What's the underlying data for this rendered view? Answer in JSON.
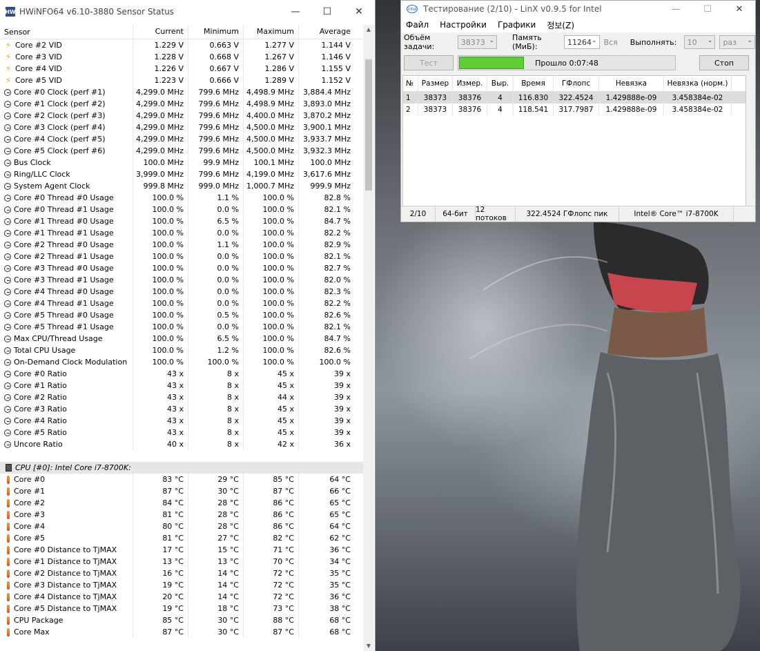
{
  "hwinfo": {
    "title": "HWiNFO64 v6.10-3880 Sensor Status",
    "columns": [
      "Sensor",
      "Current",
      "Minimum",
      "Maximum",
      "Average"
    ],
    "rows": [
      {
        "icon": "bolt",
        "name": "Core #2 VID",
        "cur": "1.229 V",
        "min": "0.663 V",
        "max": "1.277 V",
        "avg": "1.144 V"
      },
      {
        "icon": "bolt",
        "name": "Core #3 VID",
        "cur": "1.228 V",
        "min": "0.668 V",
        "max": "1.267 V",
        "avg": "1.146 V"
      },
      {
        "icon": "bolt",
        "name": "Core #4 VID",
        "cur": "1.226 V",
        "min": "0.667 V",
        "max": "1.286 V",
        "avg": "1.155 V"
      },
      {
        "icon": "bolt",
        "name": "Core #5 VID",
        "cur": "1.223 V",
        "min": "0.666 V",
        "max": "1.289 V",
        "avg": "1.152 V"
      },
      {
        "icon": "clock",
        "name": "Core #0 Clock (perf #1)",
        "cur": "4,299.0 MHz",
        "min": "799.6 MHz",
        "max": "4,498.9 MHz",
        "avg": "3,884.4 MHz"
      },
      {
        "icon": "clock",
        "name": "Core #1 Clock (perf #2)",
        "cur": "4,299.0 MHz",
        "min": "799.6 MHz",
        "max": "4,498.9 MHz",
        "avg": "3,893.0 MHz"
      },
      {
        "icon": "clock",
        "name": "Core #2 Clock (perf #3)",
        "cur": "4,299.0 MHz",
        "min": "799.6 MHz",
        "max": "4,400.0 MHz",
        "avg": "3,870.2 MHz"
      },
      {
        "icon": "clock",
        "name": "Core #3 Clock (perf #4)",
        "cur": "4,299.0 MHz",
        "min": "799.6 MHz",
        "max": "4,500.0 MHz",
        "avg": "3,900.1 MHz"
      },
      {
        "icon": "clock",
        "name": "Core #4 Clock (perf #5)",
        "cur": "4,299.0 MHz",
        "min": "799.6 MHz",
        "max": "4,500.0 MHz",
        "avg": "3,933.7 MHz"
      },
      {
        "icon": "clock",
        "name": "Core #5 Clock (perf #6)",
        "cur": "4,299.0 MHz",
        "min": "799.6 MHz",
        "max": "4,500.0 MHz",
        "avg": "3,932.3 MHz"
      },
      {
        "icon": "clock",
        "name": "Bus Clock",
        "cur": "100.0 MHz",
        "min": "99.9 MHz",
        "max": "100.1 MHz",
        "avg": "100.0 MHz"
      },
      {
        "icon": "clock",
        "name": "Ring/LLC Clock",
        "cur": "3,999.0 MHz",
        "min": "799.6 MHz",
        "max": "4,199.0 MHz",
        "avg": "3,617.6 MHz"
      },
      {
        "icon": "clock",
        "name": "System Agent Clock",
        "cur": "999.8 MHz",
        "min": "999.0 MHz",
        "max": "1,000.7 MHz",
        "avg": "999.9 MHz"
      },
      {
        "icon": "clock",
        "name": "Core #0 Thread #0 Usage",
        "cur": "100.0 %",
        "min": "1.1 %",
        "max": "100.0 %",
        "avg": "82.8 %"
      },
      {
        "icon": "clock",
        "name": "Core #0 Thread #1 Usage",
        "cur": "100.0 %",
        "min": "0.0 %",
        "max": "100.0 %",
        "avg": "82.1 %"
      },
      {
        "icon": "clock",
        "name": "Core #1 Thread #0 Usage",
        "cur": "100.0 %",
        "min": "6.5 %",
        "max": "100.0 %",
        "avg": "84.7 %"
      },
      {
        "icon": "clock",
        "name": "Core #1 Thread #1 Usage",
        "cur": "100.0 %",
        "min": "0.0 %",
        "max": "100.0 %",
        "avg": "82.2 %"
      },
      {
        "icon": "clock",
        "name": "Core #2 Thread #0 Usage",
        "cur": "100.0 %",
        "min": "1.1 %",
        "max": "100.0 %",
        "avg": "82.9 %"
      },
      {
        "icon": "clock",
        "name": "Core #2 Thread #1 Usage",
        "cur": "100.0 %",
        "min": "0.0 %",
        "max": "100.0 %",
        "avg": "82.1 %"
      },
      {
        "icon": "clock",
        "name": "Core #3 Thread #0 Usage",
        "cur": "100.0 %",
        "min": "0.0 %",
        "max": "100.0 %",
        "avg": "82.7 %"
      },
      {
        "icon": "clock",
        "name": "Core #3 Thread #1 Usage",
        "cur": "100.0 %",
        "min": "0.0 %",
        "max": "100.0 %",
        "avg": "82.0 %"
      },
      {
        "icon": "clock",
        "name": "Core #4 Thread #0 Usage",
        "cur": "100.0 %",
        "min": "0.0 %",
        "max": "100.0 %",
        "avg": "82.3 %"
      },
      {
        "icon": "clock",
        "name": "Core #4 Thread #1 Usage",
        "cur": "100.0 %",
        "min": "0.0 %",
        "max": "100.0 %",
        "avg": "82.2 %"
      },
      {
        "icon": "clock",
        "name": "Core #5 Thread #0 Usage",
        "cur": "100.0 %",
        "min": "0.5 %",
        "max": "100.0 %",
        "avg": "82.6 %"
      },
      {
        "icon": "clock",
        "name": "Core #5 Thread #1 Usage",
        "cur": "100.0 %",
        "min": "0.0 %",
        "max": "100.0 %",
        "avg": "82.1 %"
      },
      {
        "icon": "clock",
        "name": "Max CPU/Thread Usage",
        "cur": "100.0 %",
        "min": "6.5 %",
        "max": "100.0 %",
        "avg": "84.7 %"
      },
      {
        "icon": "clock",
        "name": "Total CPU Usage",
        "cur": "100.0 %",
        "min": "1.2 %",
        "max": "100.0 %",
        "avg": "82.6 %"
      },
      {
        "icon": "clock",
        "name": "On-Demand Clock Modulation",
        "cur": "100.0 %",
        "min": "100.0 %",
        "max": "100.0 %",
        "avg": "100.0 %"
      },
      {
        "icon": "clock",
        "name": "Core #0 Ratio",
        "cur": "43 x",
        "min": "8 x",
        "max": "45 x",
        "avg": "39 x"
      },
      {
        "icon": "clock",
        "name": "Core #1 Ratio",
        "cur": "43 x",
        "min": "8 x",
        "max": "45 x",
        "avg": "39 x"
      },
      {
        "icon": "clock",
        "name": "Core #2 Ratio",
        "cur": "43 x",
        "min": "8 x",
        "max": "44 x",
        "avg": "39 x"
      },
      {
        "icon": "clock",
        "name": "Core #3 Ratio",
        "cur": "43 x",
        "min": "8 x",
        "max": "45 x",
        "avg": "39 x"
      },
      {
        "icon": "clock",
        "name": "Core #4 Ratio",
        "cur": "43 x",
        "min": "8 x",
        "max": "45 x",
        "avg": "39 x"
      },
      {
        "icon": "clock",
        "name": "Core #5 Ratio",
        "cur": "43 x",
        "min": "8 x",
        "max": "45 x",
        "avg": "39 x"
      },
      {
        "icon": "clock",
        "name": "Uncore Ratio",
        "cur": "40 x",
        "min": "8 x",
        "max": "42 x",
        "avg": "36 x"
      }
    ],
    "group_title": "CPU [#0]: Intel Core i7-8700K: ...",
    "rows2": [
      {
        "icon": "temp",
        "name": "Core #0",
        "cur": "83 °C",
        "min": "29 °C",
        "max": "85 °C",
        "avg": "64 °C"
      },
      {
        "icon": "temp",
        "name": "Core #1",
        "cur": "87 °C",
        "min": "30 °C",
        "max": "87 °C",
        "avg": "66 °C"
      },
      {
        "icon": "temp",
        "name": "Core #2",
        "cur": "84 °C",
        "min": "28 °C",
        "max": "86 °C",
        "avg": "65 °C"
      },
      {
        "icon": "temp",
        "name": "Core #3",
        "cur": "81 °C",
        "min": "28 °C",
        "max": "86 °C",
        "avg": "65 °C"
      },
      {
        "icon": "temp",
        "name": "Core #4",
        "cur": "80 °C",
        "min": "28 °C",
        "max": "86 °C",
        "avg": "64 °C"
      },
      {
        "icon": "temp",
        "name": "Core #5",
        "cur": "81 °C",
        "min": "27 °C",
        "max": "82 °C",
        "avg": "62 °C"
      },
      {
        "icon": "temp",
        "name": "Core #0 Distance to TjMAX",
        "cur": "17 °C",
        "min": "15 °C",
        "max": "71 °C",
        "avg": "36 °C"
      },
      {
        "icon": "temp",
        "name": "Core #1 Distance to TjMAX",
        "cur": "13 °C",
        "min": "13 °C",
        "max": "70 °C",
        "avg": "34 °C"
      },
      {
        "icon": "temp",
        "name": "Core #2 Distance to TjMAX",
        "cur": "16 °C",
        "min": "14 °C",
        "max": "72 °C",
        "avg": "35 °C"
      },
      {
        "icon": "temp",
        "name": "Core #3 Distance to TjMAX",
        "cur": "19 °C",
        "min": "14 °C",
        "max": "72 °C",
        "avg": "35 °C"
      },
      {
        "icon": "temp",
        "name": "Core #4 Distance to TjMAX",
        "cur": "20 °C",
        "min": "14 °C",
        "max": "72 °C",
        "avg": "36 °C"
      },
      {
        "icon": "temp",
        "name": "Core #5 Distance to TjMAX",
        "cur": "19 °C",
        "min": "18 °C",
        "max": "73 °C",
        "avg": "38 °C"
      },
      {
        "icon": "temp",
        "name": "CPU Package",
        "cur": "85 °C",
        "min": "30 °C",
        "max": "88 °C",
        "avg": "68 °C"
      },
      {
        "icon": "temp",
        "name": "Core Max",
        "cur": "87 °C",
        "min": "30 °C",
        "max": "87 °C",
        "avg": "68 °C"
      }
    ]
  },
  "linx": {
    "title": "Тестирование (2/10) - LinX v0.9.5 for Intel",
    "menu": [
      "Файл",
      "Настройки",
      "Графики",
      "정보(Z)"
    ],
    "task_size_label": "Объём задачи:",
    "task_size_value": "38373",
    "memory_label": "Память (МиБ):",
    "memory_value": "11264",
    "all_label": "Вся",
    "run_label": "Выполнять:",
    "run_value": "10",
    "run_unit": "раз",
    "test_button": "Тест",
    "progress_text": "Прошло 0:07:48",
    "progress_fraction": 0.3,
    "stop_button": "Стоп",
    "columns": [
      "№",
      "Размер",
      "Измер.",
      "Выр.",
      "Время",
      "ГФлопс",
      "Невязка",
      "Невязка (норм.)"
    ],
    "results": [
      [
        "1",
        "38373",
        "38376",
        "4",
        "116.830",
        "322.4524",
        "1.429888e-09",
        "3.458384e-02"
      ],
      [
        "2",
        "38373",
        "38376",
        "4",
        "118.541",
        "317.7987",
        "1.429888e-09",
        "3.458384e-02"
      ]
    ],
    "status": [
      "2/10",
      "64-бит",
      "12 потоков",
      "322.4524 ГФлопс пик",
      "Intel® Core™ i7-8700K"
    ],
    "progress_color": "#5fcd36"
  }
}
